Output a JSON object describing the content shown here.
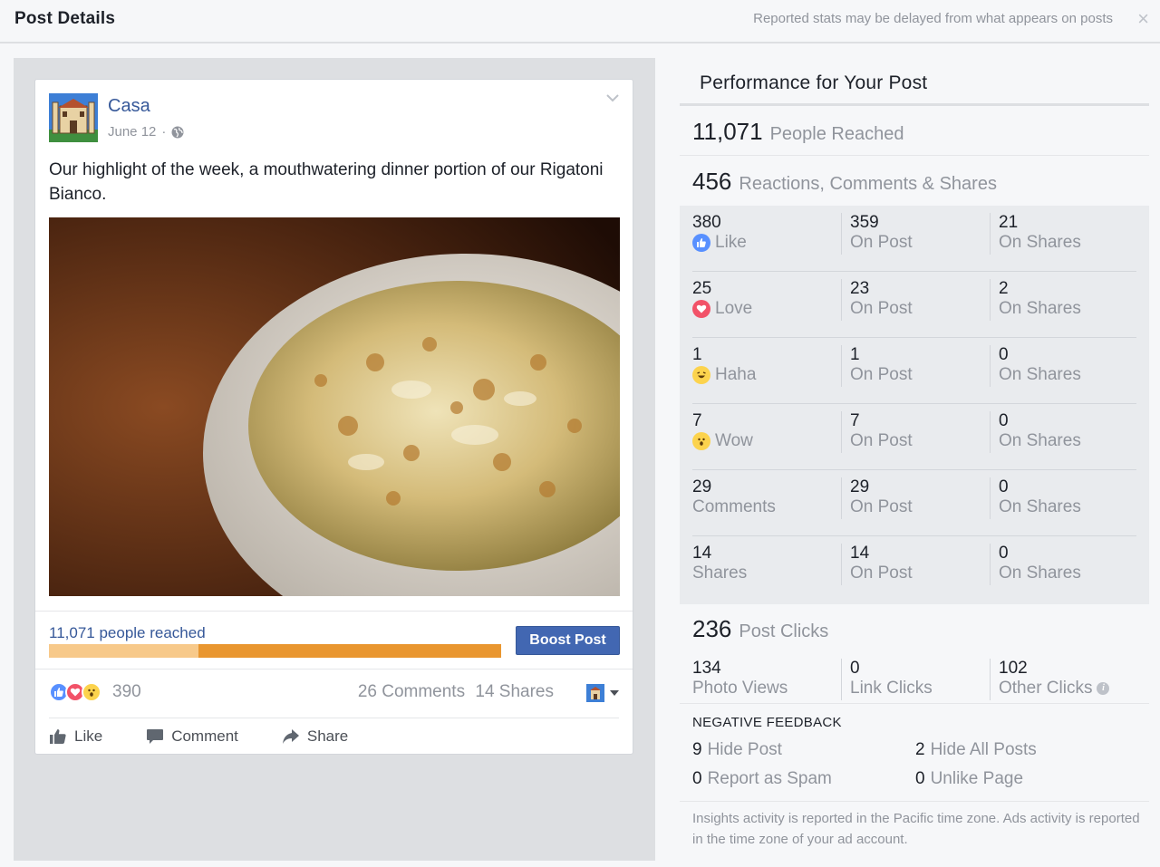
{
  "header": {
    "title": "Post Details",
    "notice": "Reported stats may be delayed from what appears on posts",
    "close_symbol": "×"
  },
  "post": {
    "page_name": "Casa",
    "date": "June 12",
    "separator": "·",
    "text": "Our highlight of the week, a mouthwatering dinner portion of our Rigatoni Bianco.",
    "reach_label": "11,071 people reached",
    "reach_bar": {
      "organic_fraction": 0.33,
      "total_fraction": 1.0,
      "organic_color": "#f7c98a",
      "paid_color": "#e9962f"
    },
    "boost_label": "Boost Post",
    "reaction_count": "390",
    "comments": "26 Comments",
    "shares": "14 Shares",
    "actions": {
      "like": "Like",
      "comment": "Comment",
      "share": "Share"
    }
  },
  "performance": {
    "title": "Performance for Your Post",
    "reached": {
      "value": "11,071",
      "label": "People Reached"
    },
    "engagement": {
      "value": "456",
      "label": "Reactions, Comments & Shares"
    },
    "rows": [
      {
        "value": "380",
        "label": "Like",
        "icon": "like-icon",
        "on_post": "359",
        "on_shares": "21"
      },
      {
        "value": "25",
        "label": "Love",
        "icon": "love-icon",
        "on_post": "23",
        "on_shares": "2"
      },
      {
        "value": "1",
        "label": "Haha",
        "icon": "haha-icon",
        "on_post": "1",
        "on_shares": "0"
      },
      {
        "value": "7",
        "label": "Wow",
        "icon": "wow-icon",
        "on_post": "7",
        "on_shares": "0"
      },
      {
        "value": "29",
        "label": "Comments",
        "icon": "",
        "on_post": "29",
        "on_shares": "0"
      },
      {
        "value": "14",
        "label": "Shares",
        "icon": "",
        "on_post": "14",
        "on_shares": "0"
      }
    ],
    "on_post_label": "On Post",
    "on_shares_label": "On Shares",
    "clicks": {
      "value": "236",
      "label": "Post Clicks",
      "photo_views": {
        "value": "134",
        "label": "Photo Views"
      },
      "link_clicks": {
        "value": "0",
        "label": "Link Clicks"
      },
      "other_clicks": {
        "value": "102",
        "label": "Other Clicks"
      }
    },
    "negative": {
      "title": "NEGATIVE FEEDBACK",
      "hide_post": {
        "value": "9",
        "label": "Hide Post"
      },
      "hide_all": {
        "value": "2",
        "label": "Hide All Posts"
      },
      "spam": {
        "value": "0",
        "label": "Report as Spam"
      },
      "unlike": {
        "value": "0",
        "label": "Unlike Page"
      }
    },
    "footnote": "Insights activity is reported in the Pacific time zone. Ads activity is reported in the time zone of your ad account."
  },
  "colors": {
    "link_blue": "#365899",
    "button_blue": "#4267b2",
    "like_blue": "#5890ff",
    "love_red": "#f25268",
    "emoji_yellow": "#fcd34d"
  }
}
